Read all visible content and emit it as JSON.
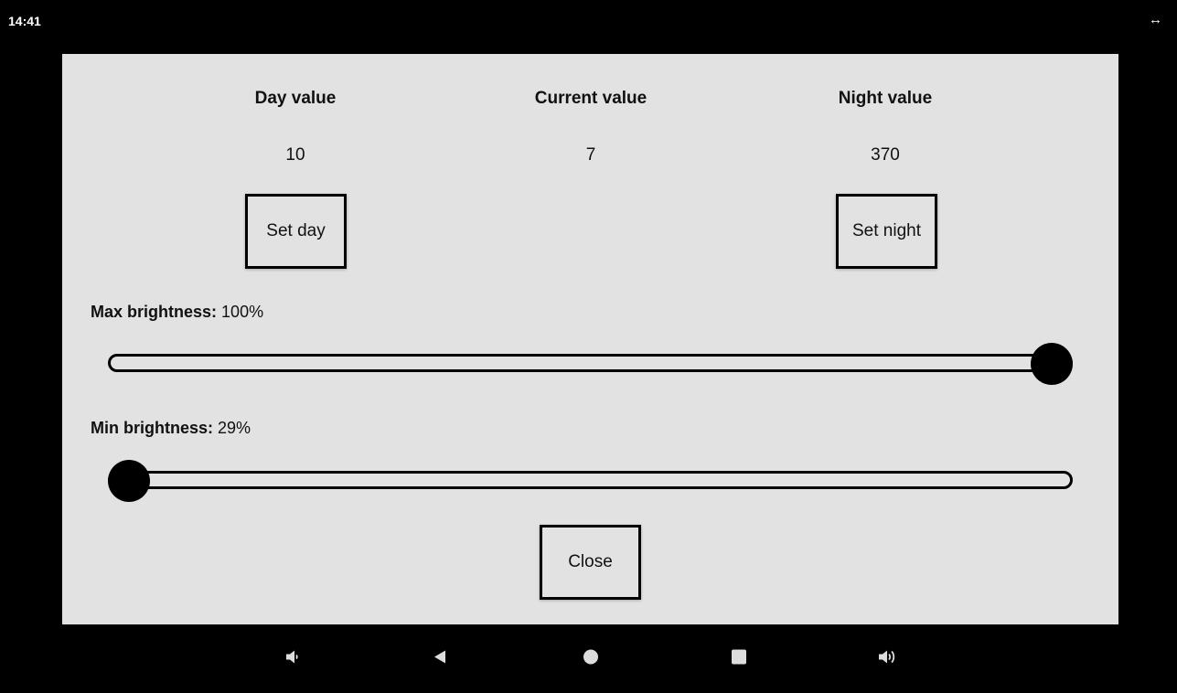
{
  "status_bar": {
    "time": "14:41",
    "rotate_icon": "rotate-arrows-icon"
  },
  "panel": {
    "columns": [
      {
        "heading": "Day value",
        "value": "10"
      },
      {
        "heading": "Current value",
        "value": "7"
      },
      {
        "heading": "Night value",
        "value": "370"
      }
    ],
    "buttons": {
      "set_day": "Set day",
      "set_night": "Set night",
      "close": "Close"
    },
    "max_brightness": {
      "label": "Max brightness:",
      "value": "100%",
      "level": 100
    },
    "min_brightness": {
      "label": "Min brightness:",
      "value": "29%",
      "level": 0
    }
  },
  "nav_bar": {
    "icons": [
      "volume-down-icon",
      "back-icon",
      "home-icon",
      "recents-icon",
      "volume-up-icon"
    ]
  },
  "colors": {
    "panel_bg": "#e2e2e2",
    "screen_bg": "#000000",
    "accent": "#000000"
  }
}
